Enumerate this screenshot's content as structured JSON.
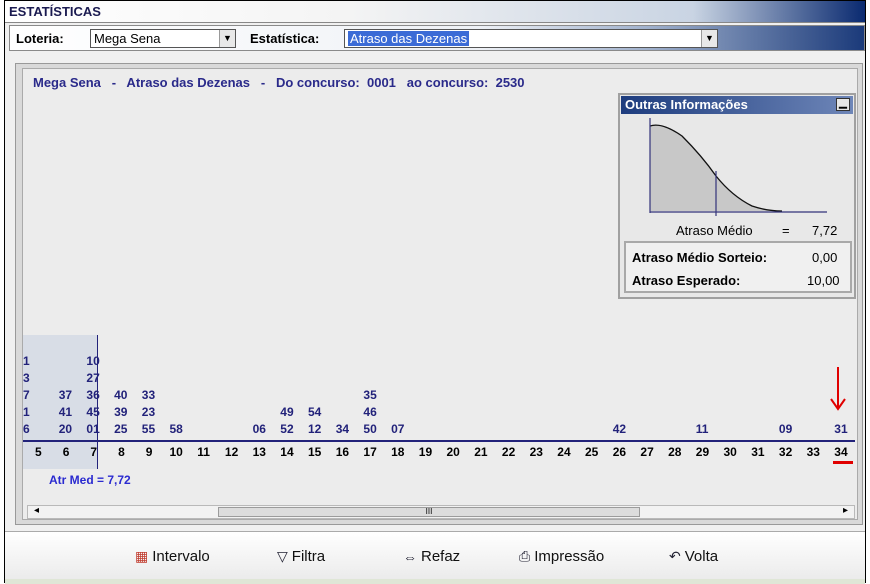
{
  "window": {
    "title": "ESTATÍSTICAS"
  },
  "toolbar": {
    "loteria_label": "Loteria:",
    "loteria_value": "Mega Sena",
    "estatistica_label": "Estatística:",
    "estatistica_value": "Atraso das Dezenas"
  },
  "header": {
    "text": "Mega Sena   -   Atraso das Dezenas   -   Do concurso:  0001   ao concurso:  2530"
  },
  "info_panel": {
    "title": "Outras Informações",
    "minimize_icon": "minimize-icon",
    "atraso_medio_label": "Atraso Médio",
    "equals": "=",
    "atraso_medio_value": "7,72",
    "atraso_medio_sorteio_label": "Atraso Médio Sorteio:",
    "atraso_medio_sorteio_value": "0,00",
    "atraso_esperado_label": "Atraso Esperado:",
    "atraso_esperado_value": "10,00"
  },
  "chart_data": {
    "type": "table",
    "x_axis": [
      "5",
      "6",
      "7",
      "8",
      "9",
      "10",
      "11",
      "12",
      "13",
      "14",
      "15",
      "16",
      "17",
      "18",
      "19",
      "20",
      "21",
      "22",
      "23",
      "24",
      "25",
      "26",
      "27",
      "28",
      "29",
      "30",
      "31",
      "32",
      "33",
      "34"
    ],
    "columns": [
      {
        "delay": "5",
        "dezenas": [
          "1",
          "3",
          "7",
          "1",
          "6"
        ]
      },
      {
        "delay": "6",
        "dezenas": [
          "37",
          "41",
          "20"
        ]
      },
      {
        "delay": "7",
        "dezenas": [
          "10",
          "27",
          "36",
          "45",
          "01"
        ]
      },
      {
        "delay": "8",
        "dezenas": [
          "40",
          "39",
          "25"
        ]
      },
      {
        "delay": "9",
        "dezenas": [
          "33",
          "23",
          "55"
        ]
      },
      {
        "delay": "10",
        "dezenas": [
          "58"
        ]
      },
      {
        "delay": "13",
        "dezenas": [
          "06"
        ]
      },
      {
        "delay": "14",
        "dezenas": [
          "49",
          "52"
        ]
      },
      {
        "delay": "15",
        "dezenas": [
          "54",
          "12"
        ]
      },
      {
        "delay": "16",
        "dezenas": [
          "34"
        ]
      },
      {
        "delay": "17",
        "dezenas": [
          "35",
          "46",
          "50"
        ]
      },
      {
        "delay": "18",
        "dezenas": [
          "07"
        ]
      },
      {
        "delay": "26",
        "dezenas": [
          "42"
        ]
      },
      {
        "delay": "29",
        "dezenas": [
          "11"
        ]
      },
      {
        "delay": "32",
        "dezenas": [
          "09"
        ]
      },
      {
        "delay": "34",
        "dezenas": [
          "31"
        ]
      }
    ],
    "mean_label": "Atr Med = 7,72",
    "highlight_column": "34",
    "colors": {
      "numbers": "#22227a",
      "highlight": "#e00000"
    }
  },
  "buttons": {
    "intervalo": "Intervalo",
    "filtra": "Filtra",
    "refaz": "Refaz",
    "impressao": "Impressão",
    "volta": "Volta"
  },
  "scrollbar": {
    "left_arrow": "◂",
    "right_arrow": "▸",
    "grip": "III"
  }
}
